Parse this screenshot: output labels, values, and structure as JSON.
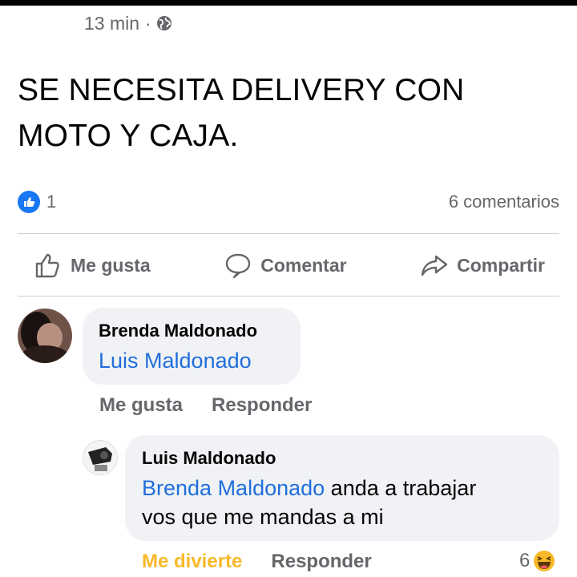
{
  "status_bar": {
    "color": "#000000"
  },
  "post": {
    "time": "13 min",
    "separator": "·",
    "privacy_icon": "globe-icon",
    "text": "SE NECESITA DELIVERY CON MOTO Y CAJA.",
    "like_count": "1",
    "comment_count": "6 comentarios",
    "actions": {
      "like": "Me gusta",
      "comment": "Comentar",
      "share": "Compartir"
    }
  },
  "comments": [
    {
      "author": "Brenda Maldonado",
      "mention": "Luis Maldonado",
      "text": "",
      "actions": {
        "like": "Me gusta",
        "reply": "Responder"
      }
    },
    {
      "author": "Luis Maldonado",
      "mention": "Brenda Maldonado",
      "text_line1": " anda a trabajar",
      "text_line2": "vos que me mandas a mi",
      "actions": {
        "like": "Me divierte",
        "reply": "Responder"
      },
      "reaction_count": "6",
      "reaction_icon": "haha-emoji-icon"
    }
  ],
  "colors": {
    "accent": "#1877f2",
    "mention": "#216fdb",
    "muted": "#65676b",
    "bubble": "#f0f2f5",
    "haha": "#f7b928"
  }
}
